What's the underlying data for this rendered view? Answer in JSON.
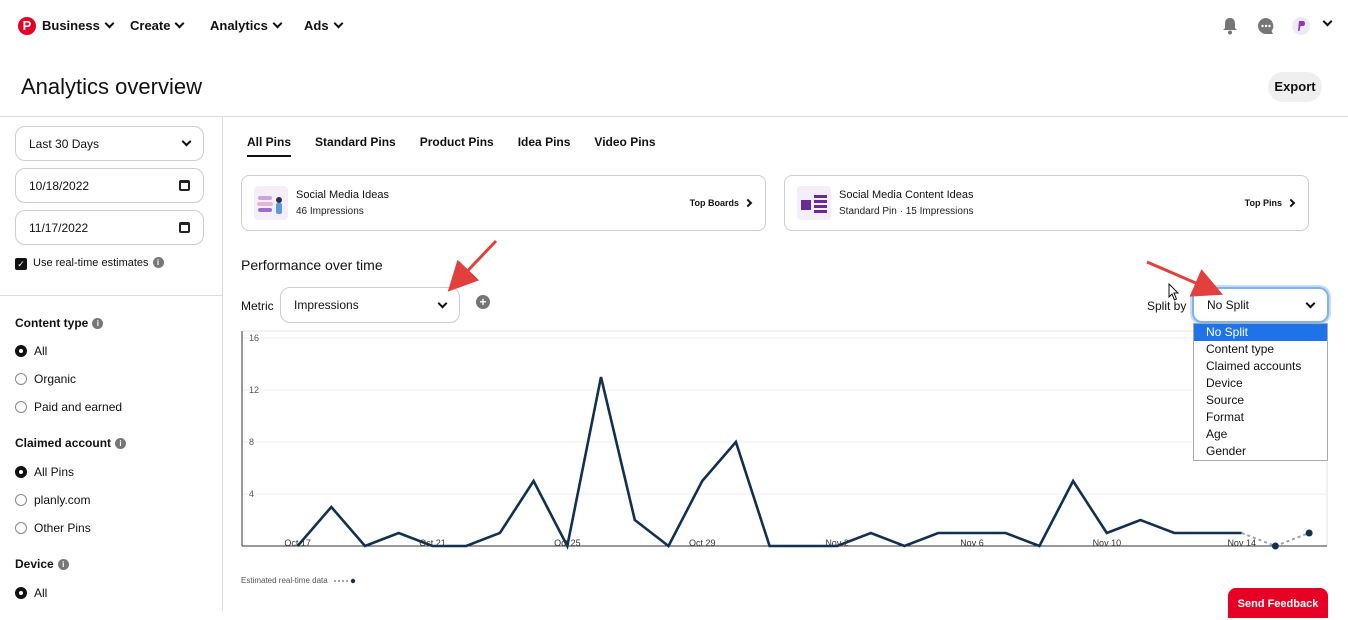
{
  "nav": {
    "logo": "P",
    "business": "Business",
    "create": "Create",
    "analytics": "Analytics",
    "ads": "Ads"
  },
  "header": {
    "title": "Analytics overview",
    "export": "Export"
  },
  "filters": {
    "date_range": "Last 30 Days",
    "start_date": "10/18/2022",
    "end_date": "11/17/2022",
    "realtime_label": "Use real-time estimates"
  },
  "content_type": {
    "heading": "Content type",
    "options": [
      "All",
      "Organic",
      "Paid and earned"
    ],
    "selected": "All"
  },
  "claimed_account": {
    "heading": "Claimed account",
    "options": [
      "All Pins",
      "planly.com",
      "Other Pins"
    ],
    "selected": "All Pins"
  },
  "device": {
    "heading": "Device",
    "options": [
      "All"
    ],
    "selected": "All"
  },
  "tabs": [
    "All Pins",
    "Standard Pins",
    "Product Pins",
    "Idea Pins",
    "Video Pins"
  ],
  "active_tab": "All Pins",
  "cards": [
    {
      "title": "Social Media Ideas",
      "subtitle": "46 Impressions",
      "link": "Top Boards"
    },
    {
      "title": "Social Media Content Ideas",
      "subtitle": "Standard Pin · 15 Impressions",
      "link": "Top Pins"
    }
  ],
  "performance": {
    "title": "Performance over time",
    "metric_label": "Metric",
    "metric_value": "Impressions",
    "split_label": "Split by",
    "split_value": "No Split",
    "split_options": [
      "No Split",
      "Content type",
      "Claimed accounts",
      "Device",
      "Source",
      "Format",
      "Age",
      "Gender"
    ]
  },
  "chart_data": {
    "type": "line",
    "x": [
      "Oct 16",
      "Oct 17",
      "Oct 18",
      "Oct 19",
      "Oct 20",
      "Oct 21",
      "Oct 22",
      "Oct 23",
      "Oct 24",
      "Oct 25",
      "Oct 26",
      "Oct 27",
      "Oct 28",
      "Oct 29",
      "Oct 30",
      "Oct 31",
      "Nov 1",
      "Nov 2",
      "Nov 3",
      "Nov 4",
      "Nov 5",
      "Nov 6",
      "Nov 7",
      "Nov 8",
      "Nov 9",
      "Nov 10",
      "Nov 11",
      "Nov 12",
      "Nov 13",
      "Nov 14",
      "Nov 15",
      "Nov 16"
    ],
    "x_tick_labels": [
      "Oct 17",
      "Oct 21",
      "Oct 25",
      "Oct 29",
      "Nov 2",
      "Nov 6",
      "Nov 10",
      "Nov 14"
    ],
    "series": [
      {
        "values": [
          null,
          0,
          3,
          0,
          1,
          0,
          0,
          1,
          5,
          0,
          13,
          2,
          0,
          5,
          8,
          0,
          0,
          0,
          1,
          0,
          1,
          1,
          1,
          0,
          5,
          1,
          2,
          1,
          1,
          1,
          0,
          1
        ]
      }
    ],
    "estimated_from": "Nov 14",
    "ylim": [
      0,
      16
    ],
    "yticks": [
      4,
      8,
      12,
      16
    ],
    "grid": true,
    "note": "Estimated real-time data"
  },
  "feedback": "Send Feedback",
  "colors": {
    "brand": "#e60023",
    "line": "#14304f",
    "selected_option": "#1e73e8"
  }
}
